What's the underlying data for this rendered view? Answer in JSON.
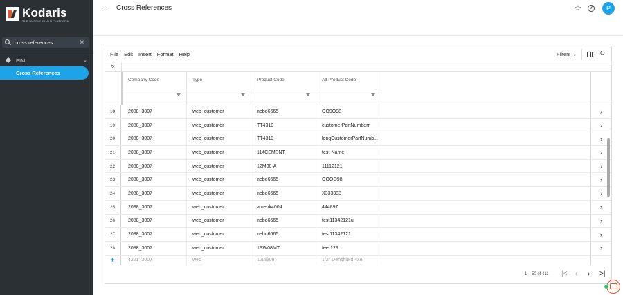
{
  "sidebar": {
    "logo_name": "Kodaris",
    "logo_tagline": "THE SUPPLY CHAIN PLATFORM",
    "search_value": "cross references",
    "group_label": "PIM",
    "active_item": "Cross References"
  },
  "header": {
    "title": "Cross References",
    "avatar_initial": "P"
  },
  "menubar": {
    "items": [
      "File",
      "Edit",
      "Insert",
      "Format",
      "Help"
    ],
    "filters_label": "Filters"
  },
  "fx_label": "fx",
  "columns": [
    "Company Code",
    "Type",
    "Product Code",
    "Alt Product Code"
  ],
  "rows": [
    {
      "num": "18",
      "company": "2088_3007",
      "type": "web_customer",
      "product": "nebo6665",
      "alt": "OO9O98"
    },
    {
      "num": "19",
      "company": "2088_3007",
      "type": "web_customer",
      "product": "TT4310",
      "alt": "customerPartNumberr"
    },
    {
      "num": "20",
      "company": "2088_3007",
      "type": "web_customer",
      "product": "TT4310",
      "alt": "longCustomerPartNumb..."
    },
    {
      "num": "21",
      "company": "2088_3007",
      "type": "web_customer",
      "product": "114CEMENT",
      "alt": "test-Name"
    },
    {
      "num": "22",
      "company": "2088_3007",
      "type": "web_customer",
      "product": "12M08-A",
      "alt": "11112121"
    },
    {
      "num": "23",
      "company": "2088_3007",
      "type": "web_customer",
      "product": "nebo6665",
      "alt": "OOOO98"
    },
    {
      "num": "24",
      "company": "2088_3007",
      "type": "web_customer",
      "product": "nebo6665",
      "alt": "X333333"
    },
    {
      "num": "25",
      "company": "2088_3007",
      "type": "web_customer",
      "product": "amehk4004",
      "alt": "444897"
    },
    {
      "num": "26",
      "company": "2088_3007",
      "type": "web_customer",
      "product": "nebo6665",
      "alt": "test11342121ui"
    },
    {
      "num": "27",
      "company": "2088_3007",
      "type": "web_customer",
      "product": "nebo6665",
      "alt": "test11342121"
    },
    {
      "num": "28",
      "company": "2088_3007",
      "type": "web_customer",
      "product": "1SW08MT",
      "alt": "teer129"
    }
  ],
  "new_row": {
    "company": "4221_3007",
    "type": "web",
    "product": "12LW08",
    "alt": "1/2\" Denshield 4x8"
  },
  "pager": {
    "text": "1 – 50 of 411"
  },
  "colors": {
    "accent": "#1ca3e8",
    "sidebar_bg": "#2b3035",
    "brand": "#e9542b"
  }
}
